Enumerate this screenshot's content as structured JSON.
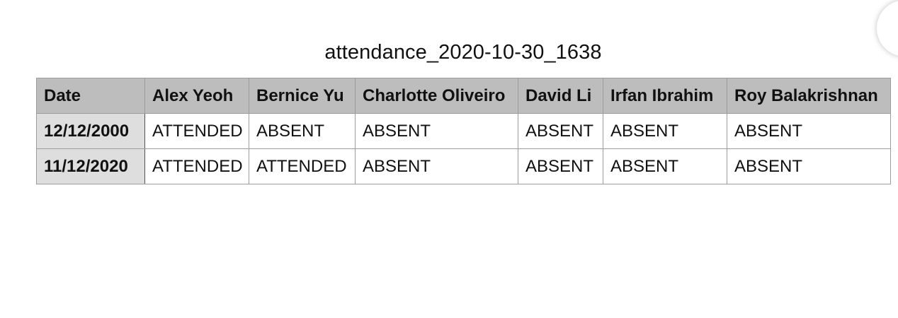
{
  "document": {
    "title": "attendance_2020-10-30_1638"
  },
  "table": {
    "columns": [
      "Date",
      "Alex Yeoh",
      "Bernice Yu",
      "Charlotte Oliveiro",
      "David Li",
      "Irfan Ibrahim",
      "Roy Balakrishnan"
    ],
    "rows": [
      {
        "date": "12/12/2000",
        "cells": [
          "ATTENDED",
          "ABSENT",
          "ABSENT",
          "ABSENT",
          "ABSENT",
          "ABSENT"
        ]
      },
      {
        "date": "11/12/2020",
        "cells": [
          "ATTENDED",
          "ATTENDED",
          "ABSENT",
          "ABSENT",
          "ABSENT",
          "ABSENT"
        ]
      }
    ]
  }
}
